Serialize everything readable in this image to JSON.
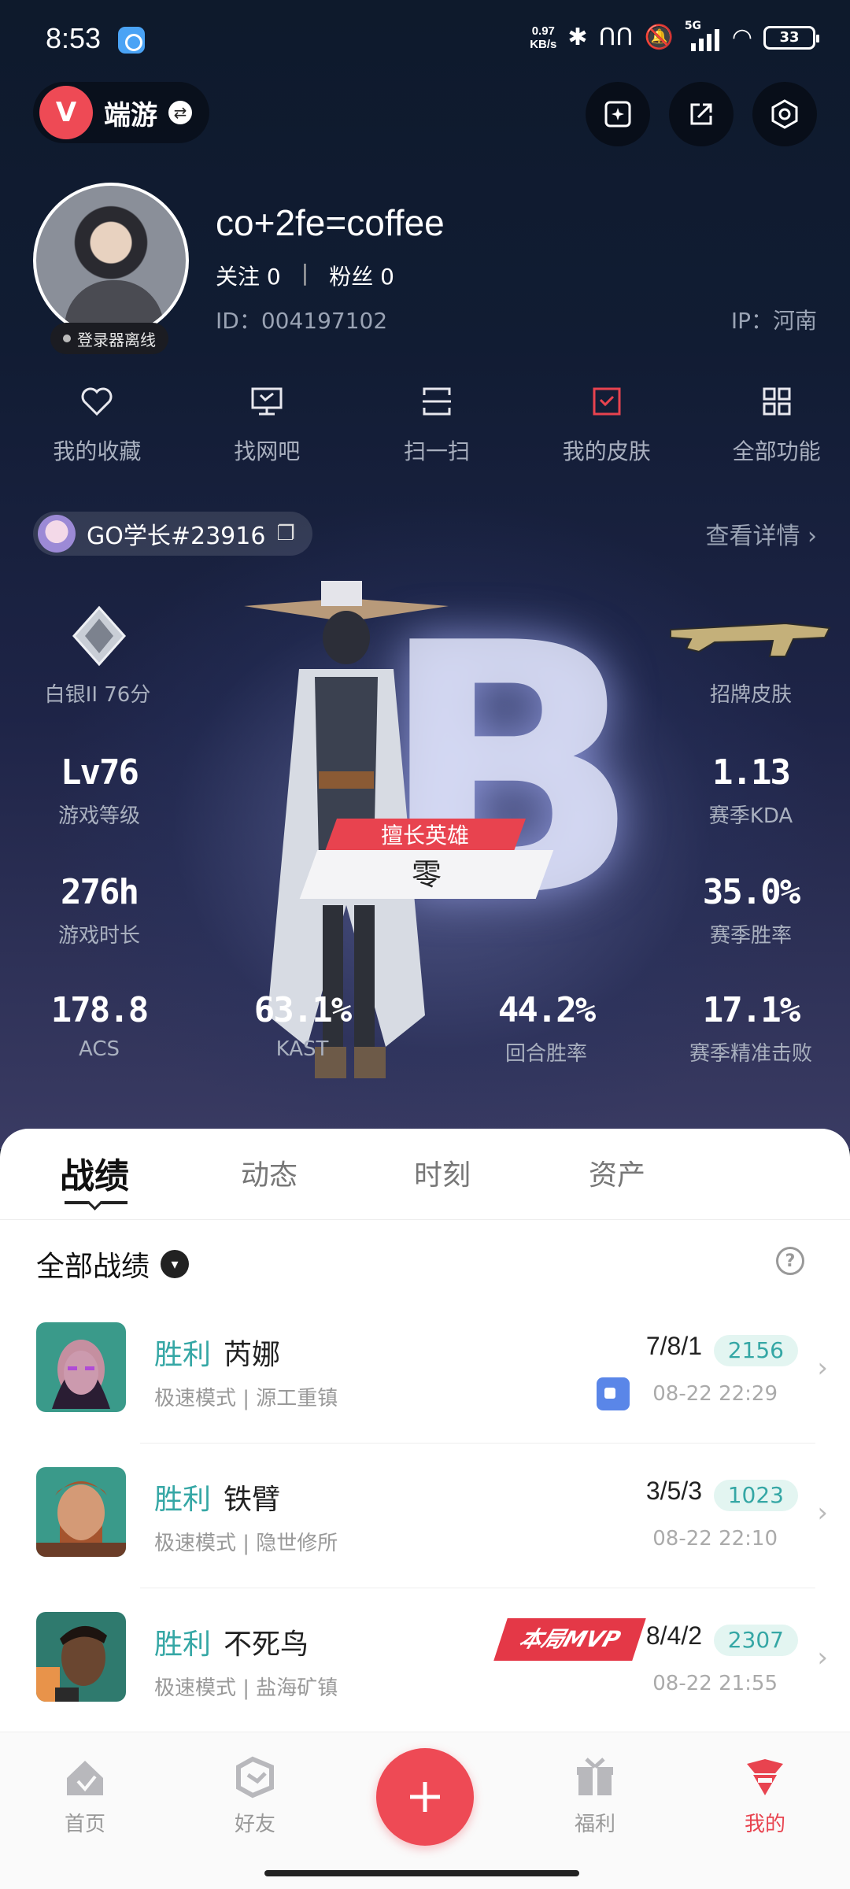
{
  "status": {
    "time": "8:53",
    "speed_value": "0.97",
    "speed_unit": "KB/s",
    "network": "5G",
    "battery": "33"
  },
  "header": {
    "game_name": "端游",
    "game_logo": "V"
  },
  "profile": {
    "username": "co+2fe=coffee",
    "follow_label": "关注",
    "follow_count": "0",
    "fans_label": "粉丝",
    "fans_count": "0",
    "id_label": "ID：004197102",
    "ip_label": "IP：河南",
    "offline_badge": "登录器离线"
  },
  "quick_actions": [
    {
      "label": "我的收藏",
      "icon": "heart-icon"
    },
    {
      "label": "找网吧",
      "icon": "monitor-icon"
    },
    {
      "label": "扫一扫",
      "icon": "scan-icon"
    },
    {
      "label": "我的皮肤",
      "icon": "skin-icon"
    },
    {
      "label": "全部功能",
      "icon": "grid-icon"
    }
  ],
  "account": {
    "riot_id": "GO学长#23916",
    "view_detail": "查看详情 ›"
  },
  "stats": {
    "rank_letter": "B",
    "rank": "白银II 76分",
    "skin_label": "招牌皮肤",
    "level_value": "Lv76",
    "level_label": "游戏等级",
    "kda_value": "1.13",
    "kda_label": "赛季KDA",
    "hours_value": "276h",
    "hours_label": "游戏时长",
    "winrate_value": "35.0%",
    "winrate_label": "赛季胜率",
    "acs_value": "178.8",
    "acs_label": "ACS",
    "kast_value": "63.1%",
    "kast_label": "KAST",
    "round_winrate_value": "44.2%",
    "round_winrate_label": "回合胜率",
    "headshot_value": "17.1%",
    "headshot_label": "赛季精准击败",
    "best_agent_tag": "擅长英雄",
    "best_agent": "零"
  },
  "tabs": [
    "战绩",
    "动态",
    "时刻",
    "资产"
  ],
  "filter": {
    "label": "全部战绩"
  },
  "matches": [
    {
      "result": "胜利",
      "agent": "芮娜",
      "mode": "极速模式 | 源工重镇",
      "kda": "7/8/1",
      "score": "2156",
      "time": "08-22 22:29",
      "avatar_color": "#5b3a70",
      "has_video": true,
      "mvp": ""
    },
    {
      "result": "胜利",
      "agent": "铁臂",
      "mode": "极速模式 | 隐世修所",
      "kda": "3/5/3",
      "score": "1023",
      "time": "08-22 22:10",
      "avatar_color": "#a5542e",
      "has_video": false,
      "mvp": ""
    },
    {
      "result": "胜利",
      "agent": "不死鸟",
      "mode": "极速模式 | 盐海矿镇",
      "kda": "8/4/2",
      "score": "2307",
      "time": "08-22 21:55",
      "avatar_color": "#3d8c7e",
      "has_video": false,
      "mvp": "本局MVP"
    }
  ],
  "bottom_nav": [
    {
      "label": "首页",
      "icon": "home-icon"
    },
    {
      "label": "好友",
      "icon": "friends-icon"
    },
    {
      "label": "福利",
      "icon": "gift-icon"
    },
    {
      "label": "我的",
      "icon": "profile-icon"
    }
  ],
  "colors": {
    "accent": "#ee4a55",
    "win": "#35a7a5"
  }
}
